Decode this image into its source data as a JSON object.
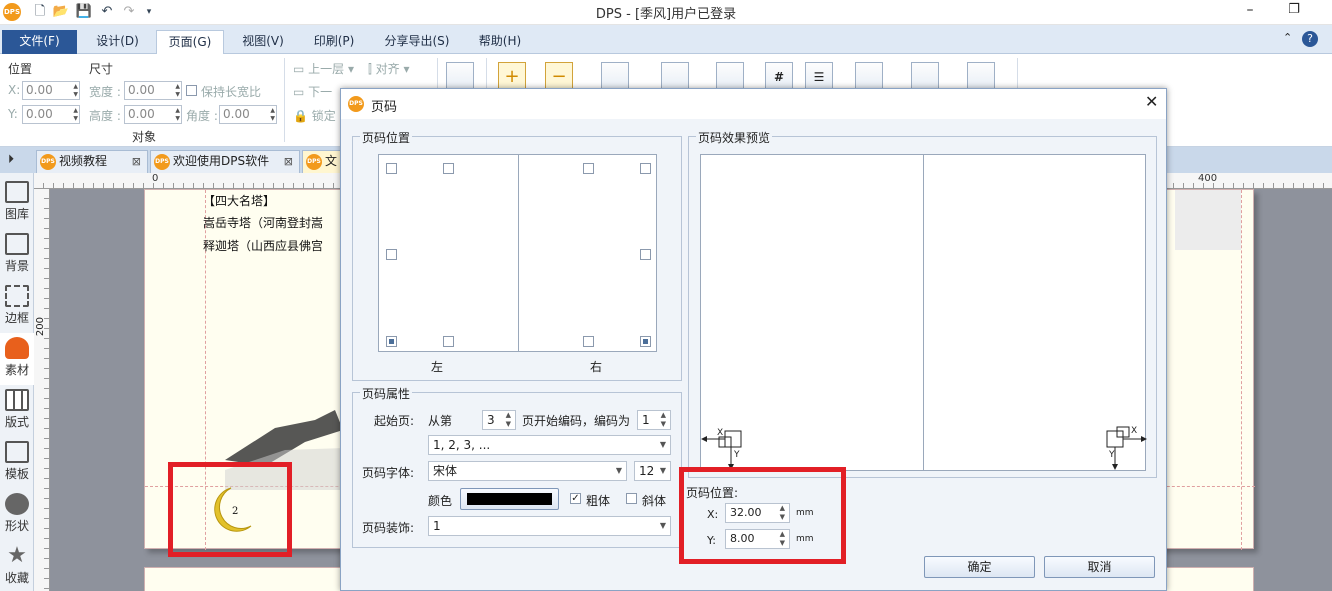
{
  "window": {
    "title": "DPS - [季风]用户已登录",
    "logo": "DPS"
  },
  "menu_tabs": [
    "文件(F)",
    "设计(D)",
    "页面(G)",
    "视图(V)",
    "印刷(P)",
    "分享导出(S)",
    "帮助(H)"
  ],
  "ribbon": {
    "position_label": "位置",
    "size_label": "尺寸",
    "x_label": "X:",
    "x_value": "0.00",
    "y_label": "Y:",
    "y_value": "0.00",
    "width_label": "宽度 :",
    "width_value": "0.00",
    "height_label": "高度 :",
    "height_value": "0.00",
    "angle_label": "角度 :",
    "angle_value": "0.00",
    "keep_ratio": "保持长宽比",
    "group_label": "对象",
    "up_layer": "上一层",
    "down_layer": "下一",
    "lock": "锁定",
    "align": "对齐"
  },
  "doc_tabs": [
    {
      "label": "视频教程"
    },
    {
      "label": "欢迎使用DPS软件"
    },
    {
      "label": "文"
    }
  ],
  "left_panel": [
    "图库",
    "背景",
    "边框",
    "素材",
    "版式",
    "模板",
    "形状",
    "收藏"
  ],
  "rulers": {
    "h0": "0",
    "h400": "400",
    "v200": "200"
  },
  "page": {
    "line1": "【四大名塔】",
    "line2": "嵩岳寺塔（河南登封嵩",
    "line3": "释迦塔（山西应县佛宫",
    "page_number": "2"
  },
  "dialog": {
    "title": "页码",
    "pos_group": "页码位置",
    "left_label": "左",
    "right_label": "右",
    "preview_group": "页码效果预览",
    "attr_group": "页码属性",
    "start_page_label": "起始页:",
    "from_label": "从第",
    "start_page": "3",
    "start_suffix": "页开始编码，编码为",
    "code_as": "1",
    "format": "1, 2, 3, ...",
    "font_label": "页码字体:",
    "font": "宋体",
    "font_size": "12",
    "color_label": "颜色",
    "color": "#000000",
    "bold_label": "粗体",
    "italic_label": "斜体",
    "decor_label": "页码装饰:",
    "decor": "1",
    "position_caption": "页码位置:",
    "x_label": "X:",
    "x_value": "32.00",
    "y_label": "Y:",
    "y_value": "8.00",
    "unit": "mm",
    "ok": "确定",
    "cancel": "取消",
    "arrow_x": "X",
    "arrow_y": "Y"
  },
  "accent_colors": {
    "highlight": "#e21f26",
    "file_tab": "#2b5797",
    "logo": "#f29a1c"
  }
}
